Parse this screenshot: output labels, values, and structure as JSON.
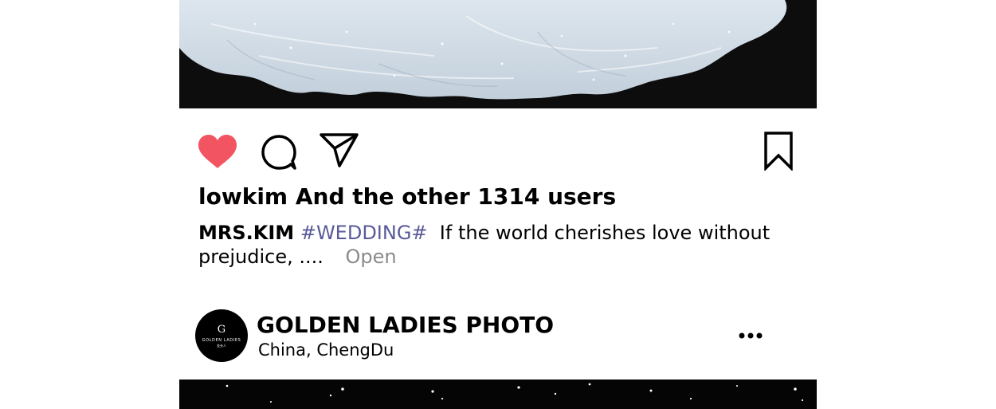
{
  "post": {
    "likes_text": "lowkim And the other 1314 users",
    "caption": {
      "user": "MRS.KIM",
      "hashtag": "#WEDDING#",
      "text": "If the world cherishes love without prejudice, ....",
      "open_label": "Open"
    },
    "icons": {
      "like": "heart-icon",
      "comment": "comment-bubble-icon",
      "share": "paper-plane-icon",
      "save": "bookmark-icon",
      "more": "more-dots-icon"
    },
    "colors": {
      "like_active": "#f25461",
      "hashtag": "#5a5a9a",
      "open_link": "#8a8a8a"
    }
  },
  "next_post": {
    "account_name": "GOLDEN LADIES PHOTO",
    "location": "China,  ChengDu",
    "avatar": {
      "mark": "G",
      "brand": "GOLDEN LADIES",
      "sub": "金夫人"
    }
  }
}
